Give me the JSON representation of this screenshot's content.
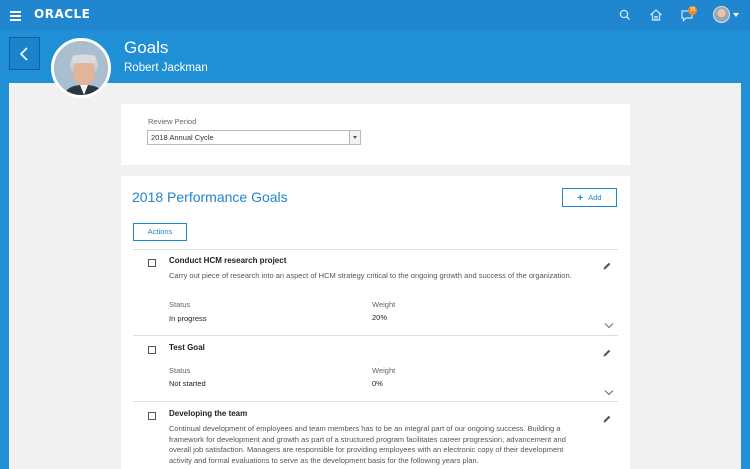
{
  "topbar": {
    "logo": "ORACLE",
    "notification_count": "15"
  },
  "header": {
    "title": "Goals",
    "person_name": "Robert Jackman"
  },
  "review": {
    "label": "Review Period",
    "selected": "2018 Annual Cycle"
  },
  "goals_section": {
    "title": "2018 Performance Goals",
    "add_label": "Add",
    "actions_label": "Actions"
  },
  "goals": [
    {
      "title": "Conduct HCM research project",
      "description": "Carry out piece of research into an aspect of HCM strategy critical to the ongoing growth and success of the organization.",
      "status_label": "Status",
      "status": "In progress",
      "weight_label": "Weight",
      "weight": "20%"
    },
    {
      "title": "Test Goal",
      "description": "",
      "status_label": "Status",
      "status": "Not started",
      "weight_label": "Weight",
      "weight": "0%"
    },
    {
      "title": "Developing the team",
      "description": "Continual development of employees and team members has to be an integral part of our ongoing success. Building a framework for development and growth as part of a structured program facilitates career progression, advancement and overall job satisfaction. Managers are responsible for providing employees with an electronic copy of their development activity and formal evaluations to serve as the development basis for the following years plan."
    }
  ],
  "colors": {
    "brand_blue": "#1f86cf",
    "badge_orange": "#f38a1f",
    "canvas_gray": "#f1f1f1"
  },
  "icons": [
    "hamburger-menu-icon",
    "search-icon",
    "home-icon",
    "notifications-icon",
    "user-avatar",
    "back-chevron-icon",
    "plus-icon",
    "edit-pencil-icon",
    "expand-chevron-icon"
  ]
}
